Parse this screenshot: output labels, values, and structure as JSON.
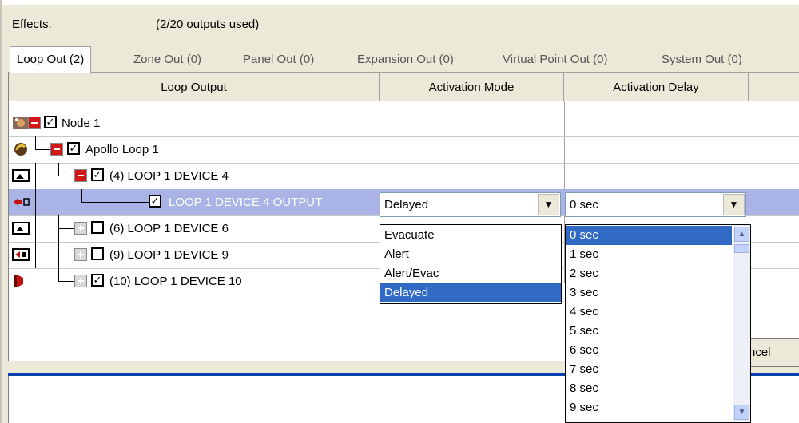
{
  "header": {
    "effects_label": "Effects:",
    "outputs_used": "(2/20 outputs used)"
  },
  "tabs": [
    {
      "label": "Loop Out (2)",
      "active": true
    },
    {
      "label": "Zone Out (0)",
      "active": false
    },
    {
      "label": "Panel Out (0)",
      "active": false
    },
    {
      "label": "Expansion Out (0)",
      "active": false
    },
    {
      "label": "Virtual Point Out (0)",
      "active": false
    },
    {
      "label": "System Out (0)",
      "active": false
    }
  ],
  "columns": [
    "Loop Output",
    "Activation Mode",
    "Activation Delay"
  ],
  "rows": [
    {
      "label": "Node 1",
      "expanded": true,
      "checked": true,
      "icon": "node-icon"
    },
    {
      "label": "Apollo Loop 1",
      "expanded": true,
      "checked": true,
      "icon": "loop-icon"
    },
    {
      "label": "(4) LOOP 1 DEVICE 4",
      "expanded": true,
      "checked": true,
      "icon": "device-icon"
    },
    {
      "label": "LOOP 1 DEVICE 4 OUTPUT",
      "checked": true,
      "selected": true,
      "icon": "output-icon"
    },
    {
      "label": "(6) LOOP 1 DEVICE 6",
      "expanded": false,
      "checked": false,
      "icon": "device-icon"
    },
    {
      "label": "(9) LOOP 1 DEVICE 9",
      "expanded": false,
      "checked": false,
      "icon": "device-output-icon"
    },
    {
      "label": "(10) LOOP 1 DEVICE 10",
      "expanded": false,
      "checked": true,
      "icon": "sounder-icon"
    }
  ],
  "activation_mode": {
    "value": "Delayed",
    "options": [
      "Evacuate",
      "Alert",
      "Alert/Evac",
      "Delayed"
    ],
    "selected_option": "Delayed"
  },
  "activation_delay": {
    "value": "0 sec",
    "options": [
      "0 sec",
      "1 sec",
      "2 sec",
      "3 sec",
      "4 sec",
      "5 sec",
      "6 sec",
      "7 sec",
      "8 sec",
      "9 sec"
    ],
    "selected_option": "0 sec"
  },
  "buttons": {
    "cancel_partial": "ncel"
  },
  "colors": {
    "selection": "#316ac5",
    "row_selected": "#a9b3e6",
    "expander_red": "#d01818",
    "accent_line": "#0b3fb0"
  }
}
